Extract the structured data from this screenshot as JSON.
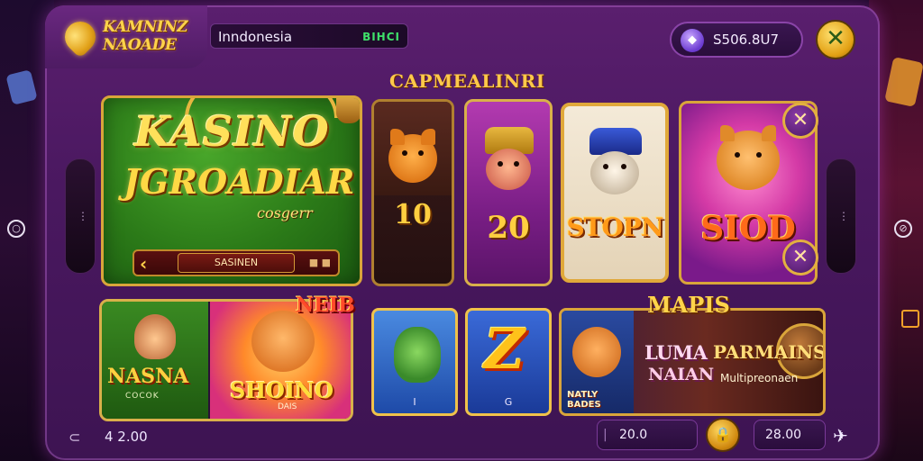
{
  "header": {
    "logo_text": "KAMNINZ\nNAOADE",
    "country_name": "Inndonesia",
    "country_code": "BIHCI",
    "balance": "S506.8U7",
    "close_glyph": "✕"
  },
  "section_title": "CAPMEALINRI",
  "hero": {
    "title_line1": "KASINO",
    "title_line2": "JGROADIAR",
    "subtitle": "cosgerr",
    "button_label": "SASINEN",
    "prev_glyph": "‹",
    "dots": "■ ■"
  },
  "top_cards": [
    {
      "value": "10"
    },
    {
      "value": "20"
    },
    {
      "value": "STOPN"
    },
    {
      "value": "SIOD"
    }
  ],
  "bottom_cards": {
    "badge_new": "NEIB",
    "game1_title": "NASNA",
    "game1_sub": "COCOK",
    "game2_title": "SHOINO",
    "game2_sub": "DAIS",
    "game3_label": "I",
    "game4_letter": "Z",
    "game4_label": "G",
    "group_title": "MAPIS",
    "game5_line1": "LUMA",
    "game5_line2": "NAIAN",
    "game5_title": "PARMAINS",
    "game5_sub": "Multipreonaen",
    "game5_badge": "NATLY\nBADES"
  },
  "footer": {
    "left_value": "4 2.00",
    "box1_value": "20.0",
    "box2_value": "28.00"
  },
  "colors": {
    "panel": "#4a1860",
    "gold": "#d9a53a",
    "accent_green": "#3fe06a"
  },
  "icons": [
    "logo-icon",
    "wallet-icon",
    "close-icon",
    "lock-icon",
    "plane-icon",
    "back-icon"
  ]
}
